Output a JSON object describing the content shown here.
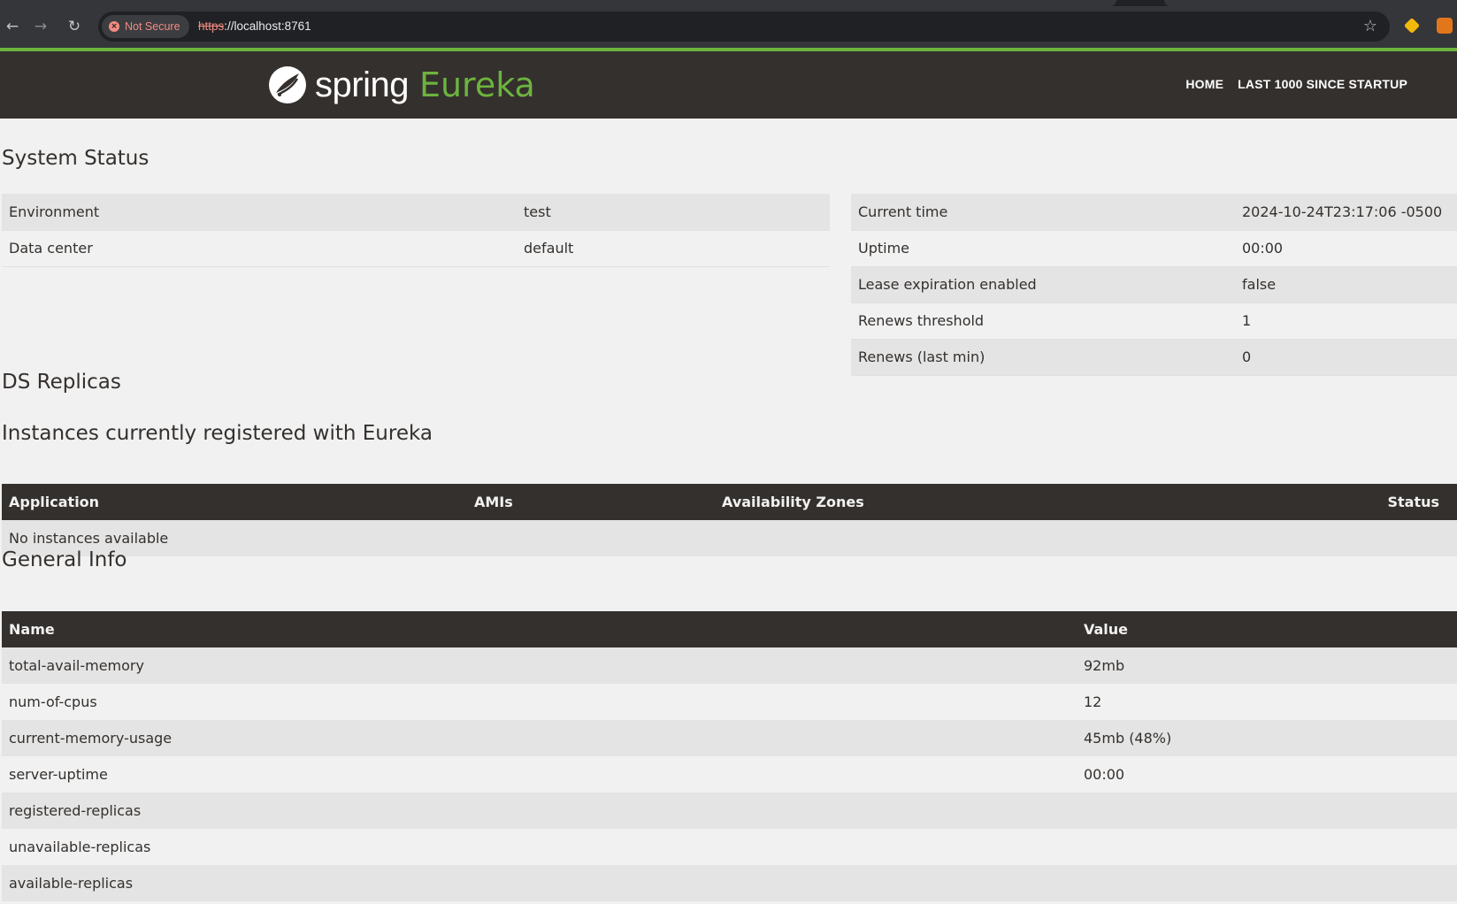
{
  "browser": {
    "security_label": "Not Secure",
    "url_scheme": "https",
    "url_rest": "://localhost:8761"
  },
  "header": {
    "logo_spring": "spring",
    "logo_eureka": "Eureka",
    "nav": [
      "HOME",
      "LAST 1000 SINCE STARTUP"
    ]
  },
  "system_status": {
    "title": "System Status",
    "left": [
      {
        "label": "Environment",
        "value": "test"
      },
      {
        "label": "Data center",
        "value": "default"
      }
    ],
    "right": [
      {
        "label": "Current time",
        "value": "2024-10-24T23:17:06 -0500"
      },
      {
        "label": "Uptime",
        "value": "00:00"
      },
      {
        "label": "Lease expiration enabled",
        "value": "false"
      },
      {
        "label": "Renews threshold",
        "value": "1"
      },
      {
        "label": "Renews (last min)",
        "value": "0"
      }
    ]
  },
  "ds_replicas": {
    "title": "DS Replicas"
  },
  "instances": {
    "title": "Instances currently registered with Eureka",
    "columns": [
      "Application",
      "AMIs",
      "Availability Zones",
      "Status"
    ],
    "empty_message": "No instances available"
  },
  "general_info": {
    "title": "General Info",
    "columns": [
      "Name",
      "Value"
    ],
    "rows": [
      {
        "name": "total-avail-memory",
        "value": "92mb"
      },
      {
        "name": "num-of-cpus",
        "value": "12"
      },
      {
        "name": "current-memory-usage",
        "value": "45mb (48%)"
      },
      {
        "name": "server-uptime",
        "value": "00:00"
      },
      {
        "name": "registered-replicas",
        "value": ""
      },
      {
        "name": "unavailable-replicas",
        "value": ""
      },
      {
        "name": "available-replicas",
        "value": ""
      }
    ]
  },
  "colors": {
    "header_bg": "#34302d",
    "brand_green": "#6db33f",
    "page_bg": "#f1f1f1",
    "row_alt": "#e4e4e4"
  }
}
